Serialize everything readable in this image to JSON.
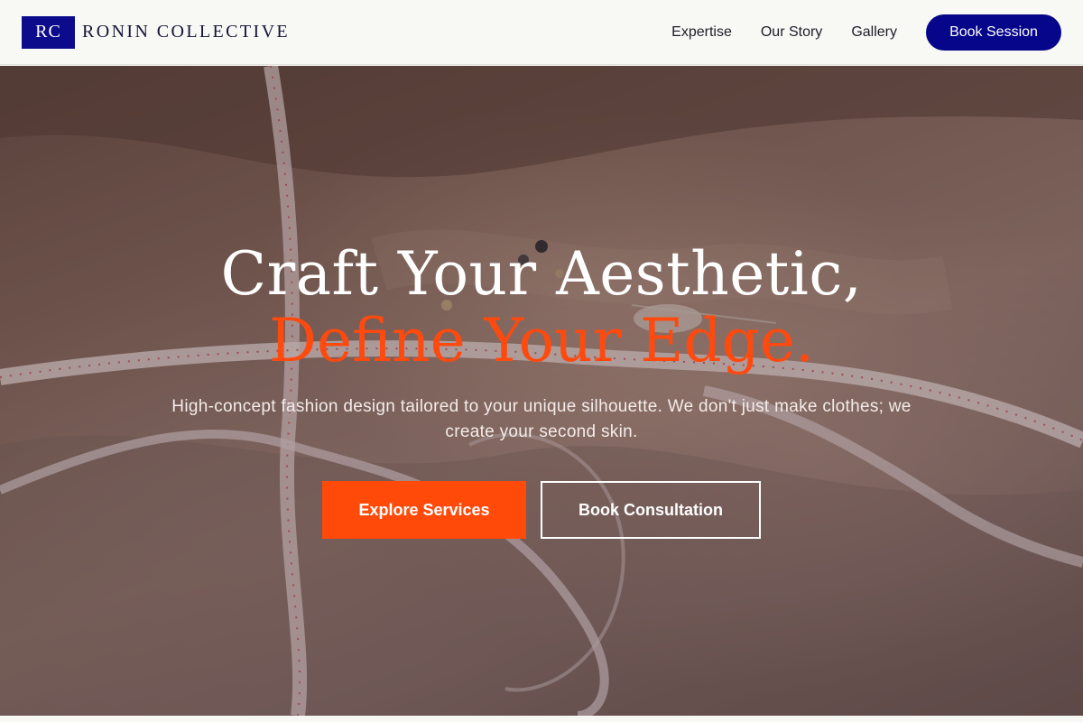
{
  "brand": {
    "mark": "RC",
    "name": "RONIN COLLECTIVE"
  },
  "nav": {
    "links": [
      {
        "label": "Expertise"
      },
      {
        "label": "Our Story"
      },
      {
        "label": "Gallery"
      }
    ],
    "cta_label": "Book Session"
  },
  "hero": {
    "background_image": "fabric-tape-measure-photo",
    "headline_line1": "Craft Your Aesthetic,",
    "headline_line2": "Define Your Edge.",
    "subtitle": "High-concept fashion design tailored to your unique silhouette. We don't just make clothes; we create your second skin.",
    "primary_button": "Explore Services",
    "secondary_button": "Book Consultation"
  },
  "colors": {
    "brand_navy": "#06068a",
    "accent_orange": "#ff4a0a",
    "nav_background": "#f8f8f4"
  }
}
